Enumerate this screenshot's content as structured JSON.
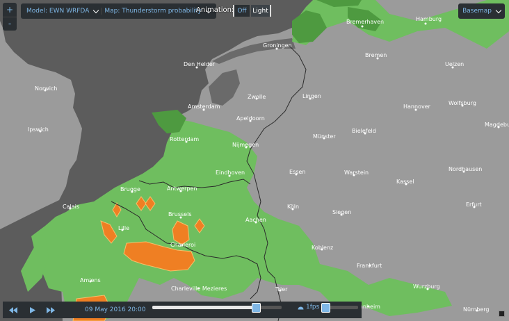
{
  "zoom": {
    "in_label": "+",
    "out_label": "-"
  },
  "toolbar": {
    "model_label": "Model: EWN WRFDA",
    "map_label": "Map: Thunderstorm probability",
    "animation_label": "Animation:",
    "off_label": "Off",
    "light_label": "Light",
    "basemap_label": "Basemap"
  },
  "playback": {
    "timestamp": "09 May 2016 20:00",
    "fps_label": "1fps",
    "progress_fraction": 0.8
  },
  "colors": {
    "land": "#9b9b9b",
    "sea": "#5c5c5c",
    "low_probability": "#6fbe5f",
    "medium_probability": "#4e9a40",
    "high_probability": "#ef7f23",
    "borders": "#2b2b2b",
    "accent": "#7fb7e6"
  },
  "cities": [
    {
      "name": "Bremerhaven"
    },
    {
      "name": "Hamburg"
    },
    {
      "name": "Groningen"
    },
    {
      "name": "Bremen"
    },
    {
      "name": "Den Helder"
    },
    {
      "name": "Uelzen"
    },
    {
      "name": "Norwich"
    },
    {
      "name": "Zwolle"
    },
    {
      "name": "Lingen"
    },
    {
      "name": "Amsterdam"
    },
    {
      "name": "Hannover"
    },
    {
      "name": "Wolfsburg"
    },
    {
      "name": "Apeldoorn"
    },
    {
      "name": "Ipswich"
    },
    {
      "name": "Magdeburg"
    },
    {
      "name": "Rotterdam"
    },
    {
      "name": "Bielefeld"
    },
    {
      "name": "Münster"
    },
    {
      "name": "Nijmegen"
    },
    {
      "name": "Eindhoven"
    },
    {
      "name": "Essen"
    },
    {
      "name": "Nordhausen"
    },
    {
      "name": "Warstein"
    },
    {
      "name": "Brugge"
    },
    {
      "name": "Antwerpen"
    },
    {
      "name": "Kassel"
    },
    {
      "name": "Calais"
    },
    {
      "name": "Köln"
    },
    {
      "name": "Erfurt"
    },
    {
      "name": "Brussels"
    },
    {
      "name": "Siegen"
    },
    {
      "name": "Lille"
    },
    {
      "name": "Aachen"
    },
    {
      "name": "Charleroi"
    },
    {
      "name": "Koblenz"
    },
    {
      "name": "Frankfurt"
    },
    {
      "name": "Amiens"
    },
    {
      "name": "Charleville Mezieres"
    },
    {
      "name": "Trier"
    },
    {
      "name": "Wurzburg"
    },
    {
      "name": "Mannheim"
    },
    {
      "name": "Nürnberg"
    }
  ]
}
